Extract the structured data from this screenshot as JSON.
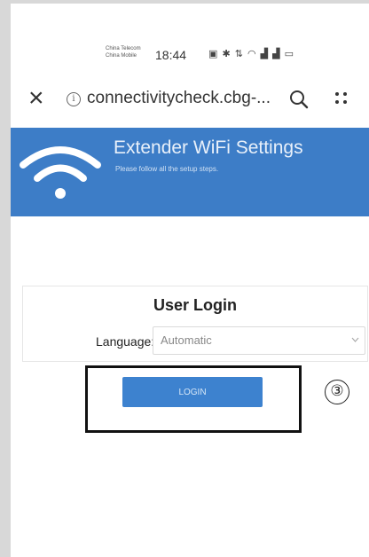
{
  "status_bar": {
    "carrier_1": "China Telecom",
    "carrier_2": "China Mobile",
    "time": "18:44",
    "icons": [
      "nfc-icon",
      "bluetooth-icon",
      "data-icon",
      "wifi-signal-icon",
      "cellular-signal-icon",
      "cellular-signal-icon",
      "battery-icon"
    ],
    "icons_text": "▣ ✱ ⇅ ◠ ▟ ▟ ▭"
  },
  "browser": {
    "url": "connectivitycheck.cbg-...",
    "icons": [
      "close-icon",
      "info-icon",
      "search-icon",
      "menu-icon"
    ]
  },
  "banner": {
    "title": "Extender WiFi Settings",
    "subtitle": "Please follow all the setup steps.",
    "color": "#3d7dc7",
    "icon": "wifi-icon"
  },
  "login": {
    "title": "User Login",
    "language_label": "Language:",
    "language_value": "Automatic",
    "button_label": "LOGIN",
    "button_color": "#3d82cf"
  },
  "annotation": {
    "step_marker": "③"
  }
}
